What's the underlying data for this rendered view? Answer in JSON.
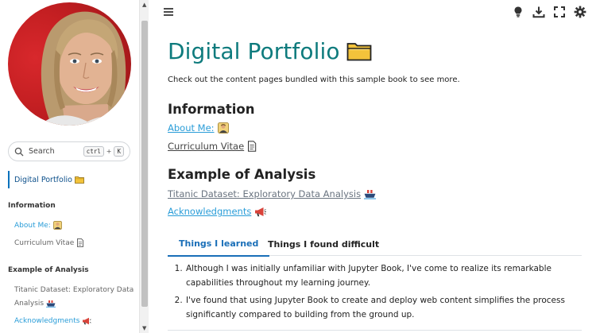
{
  "sidebar": {
    "search": {
      "placeholder": "Search",
      "key1": "ctrl",
      "plus": "+",
      "key2": "K"
    },
    "active_item": {
      "label": "Digital Portfolio",
      "icon": "folder-icon"
    },
    "sections": [
      {
        "caption": "Information",
        "items": [
          {
            "label": "About Me:",
            "icon": "person-icon"
          },
          {
            "label": "Curriculum Vitae",
            "icon": "page-icon"
          }
        ]
      },
      {
        "caption": "Example of Analysis",
        "items": [
          {
            "label": "Titanic Dataset: Exploratory Data Analysis",
            "icon": "ship-icon"
          },
          {
            "label": "Acknowledgments",
            "icon": "megaphone-icon"
          }
        ]
      }
    ]
  },
  "header": {
    "icons": [
      "menu-icon",
      "lightbulb-icon",
      "download-icon",
      "fullscreen-icon",
      "settings-icon"
    ]
  },
  "main": {
    "title": "Digital Portfolio",
    "title_icon": "folder-icon",
    "intro": "Check out the content pages bundled with this sample book to see more.",
    "sections": [
      {
        "heading": "Information",
        "links": [
          {
            "label": "About Me:",
            "icon": "person-icon"
          },
          {
            "label": "Curriculum Vitae",
            "icon": "page-icon"
          }
        ]
      },
      {
        "heading": "Example of Analysis",
        "links": [
          {
            "label": "Titanic Dataset: Exploratory Data Analysis",
            "icon": "ship-icon"
          },
          {
            "label": "Acknowledgments",
            "icon": "megaphone-icon"
          }
        ]
      }
    ],
    "tabs": [
      {
        "label": "Things I learned",
        "active": true
      },
      {
        "label": "Things I found difficult",
        "active": false
      }
    ],
    "learned_items": [
      "Although I was initially unfamiliar with Jupyter Book, I've come to realize its remarkable capabilities throughout my learning journey.",
      "I've found that using Jupyter Book to create and deploy web content simplifies the process significantly compared to building from the ground up."
    ]
  },
  "colors": {
    "title": "#0e7b7d",
    "link": "#2a9dd8",
    "active_tab": "#1a6fb8",
    "nav_accent": "#0071bc"
  }
}
